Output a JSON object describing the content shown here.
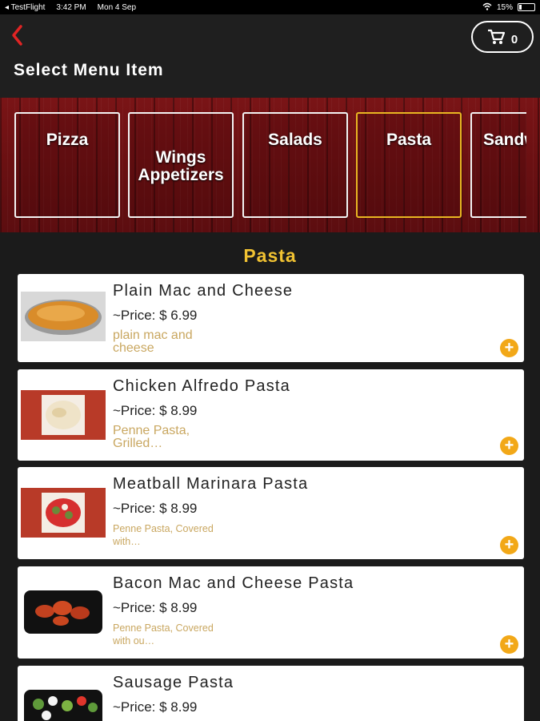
{
  "status_bar": {
    "carrier": "◂ TestFlight",
    "time": "3:42 PM",
    "date": "Mon 4 Sep",
    "battery": "15%"
  },
  "header": {
    "title": "Select Menu Item",
    "cart_count": "0"
  },
  "categories": [
    {
      "label": "Pizza"
    },
    {
      "label": "Wings\nAppetizers"
    },
    {
      "label": "Salads"
    },
    {
      "label": "Pasta",
      "active": true
    },
    {
      "label": "Sandwiches"
    }
  ],
  "section_title": "Pasta",
  "items": [
    {
      "name": "Plain Mac and Cheese",
      "price": "~Price: $ 6.99",
      "description": "plain mac and cheese"
    },
    {
      "name": "Chicken Alfredo Pasta",
      "price": "~Price: $ 8.99",
      "description": "Penne Pasta, Grilled…"
    },
    {
      "name": "Meatball Marinara Pasta",
      "price": "~Price: $ 8.99",
      "description": "Penne Pasta, Covered with…"
    },
    {
      "name": "Bacon Mac and Cheese Pasta",
      "price": "~Price: $ 8.99",
      "description": "Penne Pasta, Covered with ou…"
    },
    {
      "name": "Sausage Pasta",
      "price": "~Price: $ 8.99",
      "description": ""
    }
  ],
  "colors": {
    "accent": "#f1c232",
    "add_button": "#f2a818",
    "back_arrow": "#e02424",
    "wood": "#6a1012",
    "description": "#c9a760"
  },
  "icons": {
    "back": "chevron-left-icon",
    "cart": "cart-icon",
    "add": "plus-circle-icon"
  }
}
